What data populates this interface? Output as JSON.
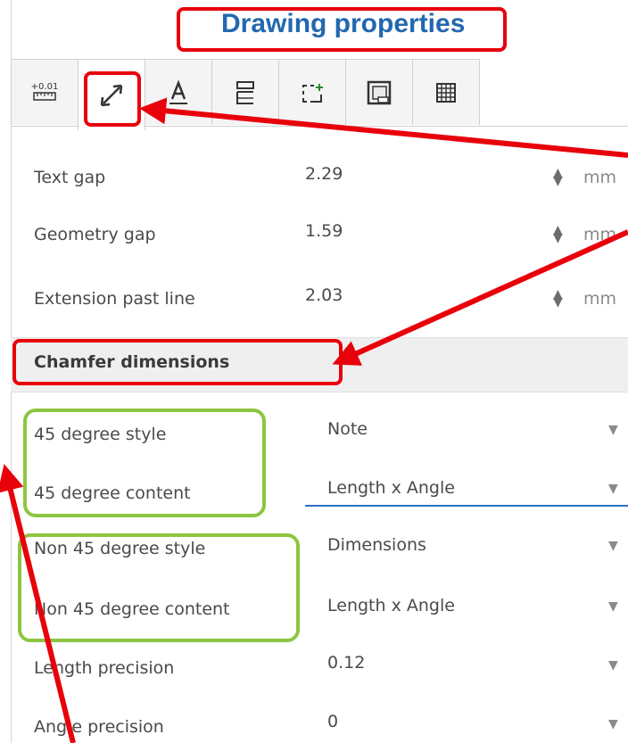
{
  "title": "Drawing properties",
  "tabs": [
    {
      "icon": "ruler-precision-icon",
      "glyph": "+0.01"
    },
    {
      "icon": "dimension-arrow-icon"
    },
    {
      "icon": "text-underline-icon"
    },
    {
      "icon": "layout-icon"
    },
    {
      "icon": "datum-icon"
    },
    {
      "icon": "border-icon"
    },
    {
      "icon": "table-grid-icon"
    }
  ],
  "gap_rows": [
    {
      "label": "Text gap",
      "value": "2.29",
      "unit": "mm"
    },
    {
      "label": "Geometry gap",
      "value": "1.59",
      "unit": "mm"
    },
    {
      "label": "Extension past line",
      "value": "2.03",
      "unit": "mm"
    }
  ],
  "section_title": "Chamfer dimensions",
  "chamfer_rows": [
    {
      "label": "45 degree style",
      "value": "Note"
    },
    {
      "label": "45 degree content",
      "value": "Length x Angle"
    },
    {
      "label": "Non 45 degree style",
      "value": "Dimensions"
    },
    {
      "label": "Non 45 degree content",
      "value": "Length x Angle"
    },
    {
      "label": "Length precision",
      "value": "0.12"
    },
    {
      "label": "Angle precision",
      "value": "0"
    }
  ],
  "colors": {
    "accent": "#2268b0",
    "annotation_red": "#e8000b",
    "annotation_green": "#8cc63f",
    "focus_blue": "#2d71c4"
  }
}
